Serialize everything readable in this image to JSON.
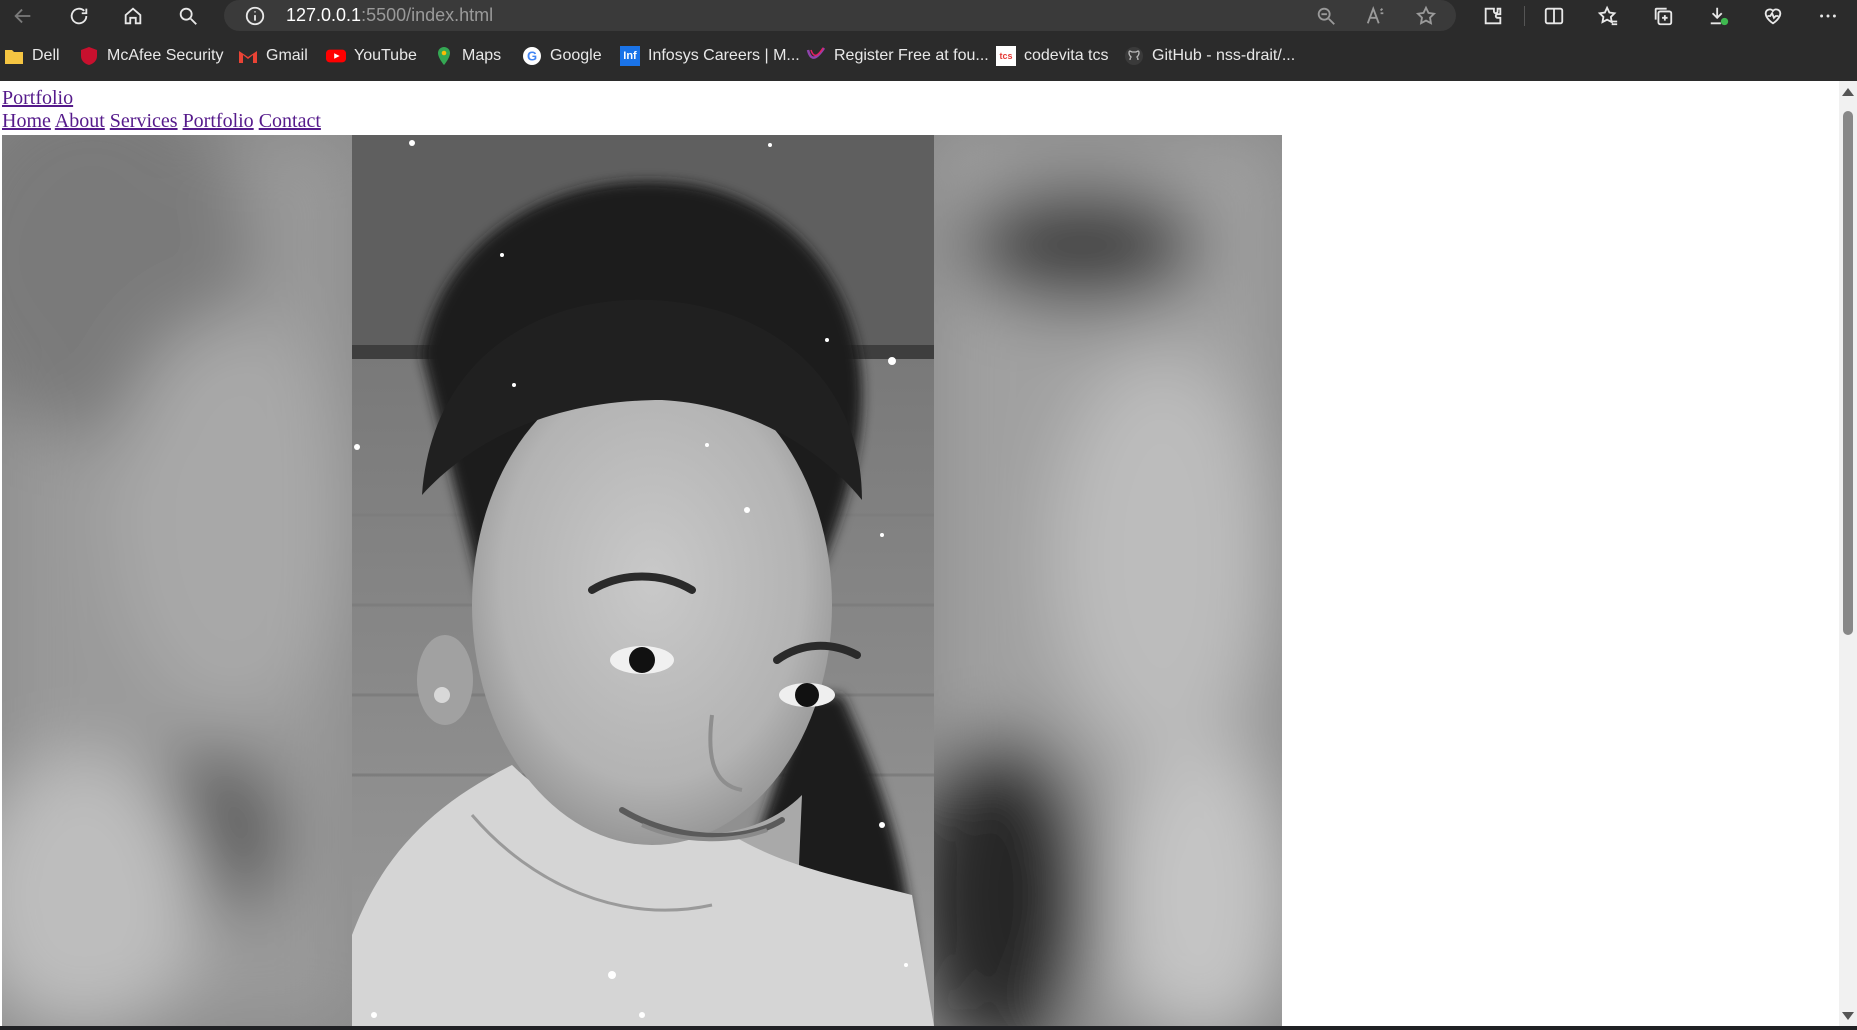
{
  "browser": {
    "url_host": "127.0.0.1",
    "url_path": ":5500/index.html",
    "toolbar_icons": [
      "back-icon",
      "refresh-icon",
      "home-icon",
      "search-icon",
      "info-icon",
      "zoom-out-icon",
      "read-aloud-icon",
      "favorite-star-icon",
      "extensions-icon",
      "split-screen-icon",
      "favorites-icon",
      "collections-icon",
      "downloads-icon",
      "browser-essentials-icon",
      "more-menu-icon"
    ]
  },
  "bookmarks": [
    {
      "label": "Dell",
      "icon": "folder-icon",
      "color": "#f5c542"
    },
    {
      "label": "McAfee Security",
      "icon": "mcafee-shield-icon",
      "color": "#c8102e"
    },
    {
      "label": "Gmail",
      "icon": "gmail-icon",
      "color": "#ea4335"
    },
    {
      "label": "YouTube",
      "icon": "youtube-icon",
      "color": "#ff0000"
    },
    {
      "label": "Maps",
      "icon": "maps-pin-icon",
      "color": "#34a853"
    },
    {
      "label": "Google",
      "icon": "google-icon",
      "color": "#4285f4"
    },
    {
      "label": "Infosys Careers | M...",
      "icon": "infosys-icon",
      "color": "#1a73e8"
    },
    {
      "label": "Register Free at fou...",
      "icon": "swoosh-icon",
      "color": "#8e44ad"
    },
    {
      "label": "codevita tcs",
      "icon": "tcs-icon",
      "color": "#e53935"
    },
    {
      "label": "GitHub - nss-drait/...",
      "icon": "github-icon",
      "color": "#ffffff"
    }
  ],
  "site": {
    "logo": "Portfolio",
    "nav": [
      "Home",
      "About",
      "Services",
      "Portfolio",
      "Contact"
    ],
    "hero_image_alt": "profile-photo"
  },
  "colors": {
    "chrome_bg": "#2b2b2b",
    "link_visited": "#551a8b",
    "page_bg": "#ffffff"
  }
}
